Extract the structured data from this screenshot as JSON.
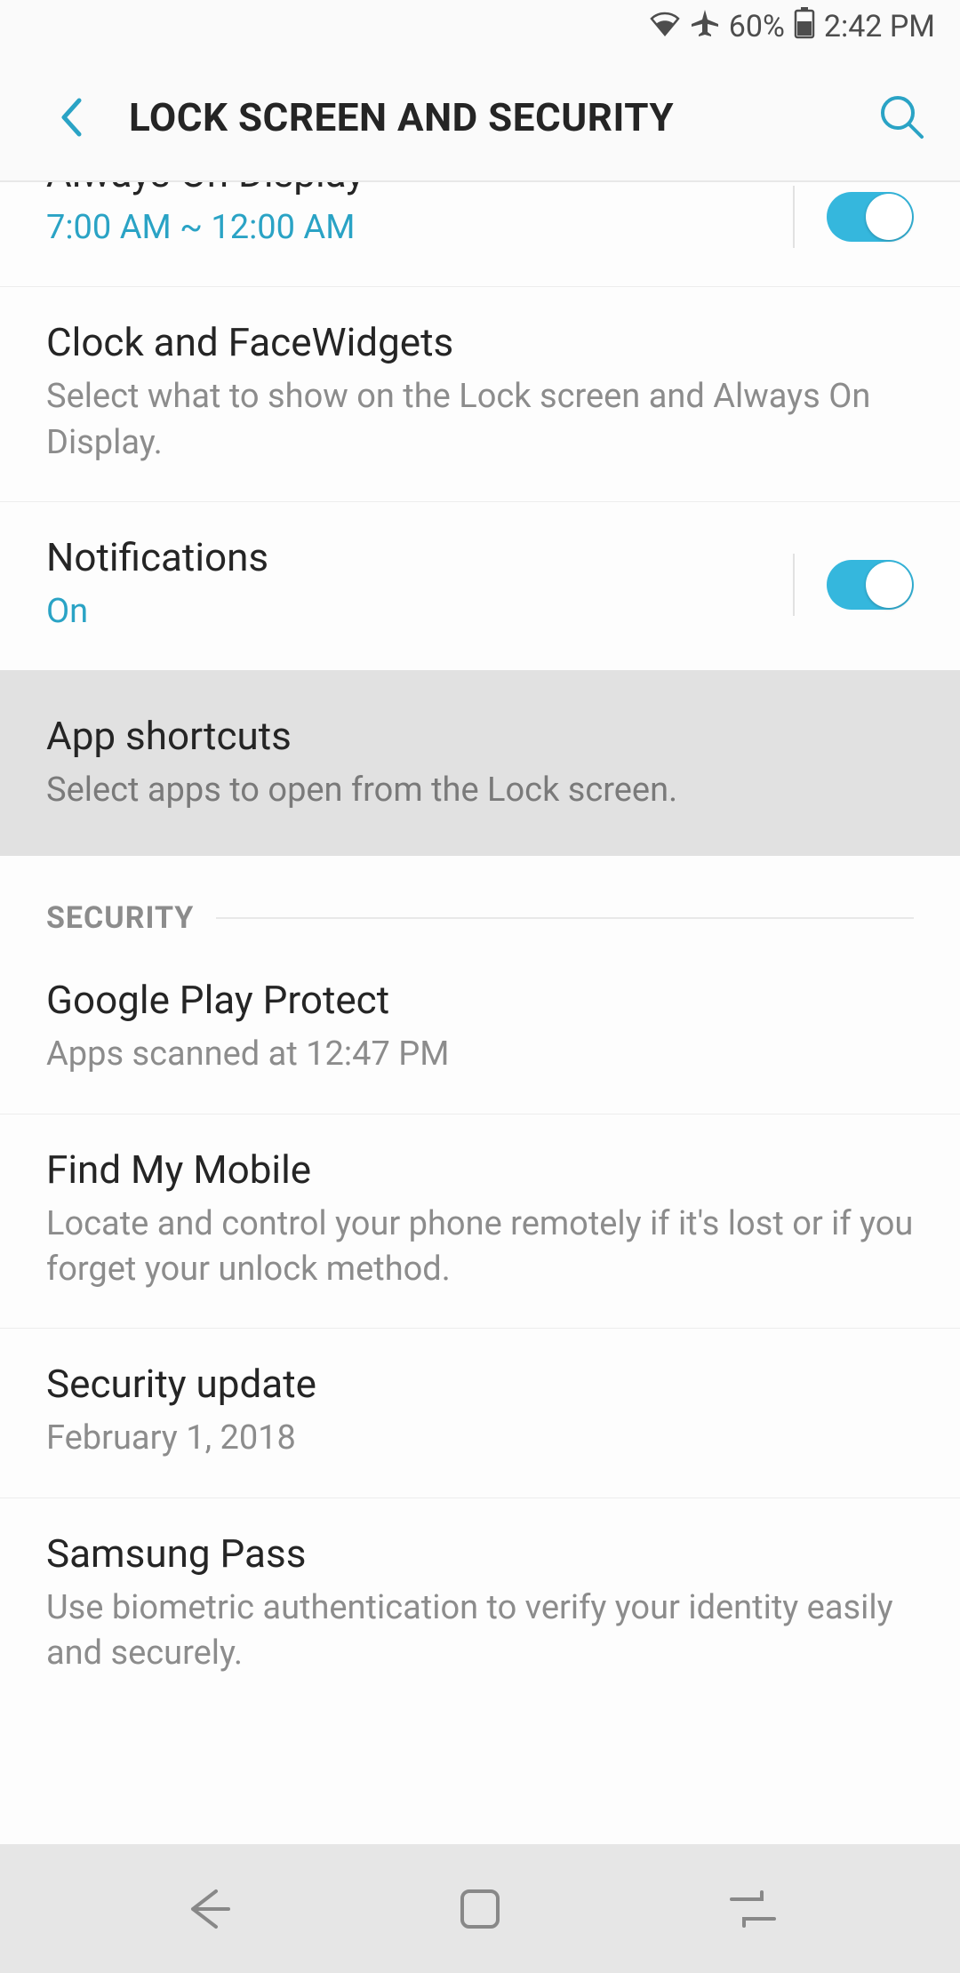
{
  "status": {
    "battery_text": "60%",
    "time": "2:42 PM"
  },
  "appbar": {
    "title": "LOCK SCREEN AND SECURITY"
  },
  "rows": {
    "always_on": {
      "title": "Always On Display",
      "sub": "7:00 AM ~ 12:00 AM"
    },
    "clock_widgets": {
      "title": "Clock and FaceWidgets",
      "sub": "Select what to show on the Lock screen and Always On Display."
    },
    "notifications": {
      "title": "Notifications",
      "sub": "On"
    },
    "app_shortcuts": {
      "title": "App shortcuts",
      "sub": "Select apps to open from the Lock screen."
    },
    "google_play_protect": {
      "title": "Google Play Protect",
      "sub": "Apps scanned at 12:47 PM"
    },
    "find_my_mobile": {
      "title": "Find My Mobile",
      "sub": "Locate and control your phone remotely if it's lost or if you forget your unlock method."
    },
    "security_update": {
      "title": "Security update",
      "sub": "February 1, 2018"
    },
    "samsung_pass": {
      "title": "Samsung Pass",
      "sub": "Use biometric authentication to verify your identity easily and securely."
    }
  },
  "section": {
    "security": "SECURITY"
  }
}
